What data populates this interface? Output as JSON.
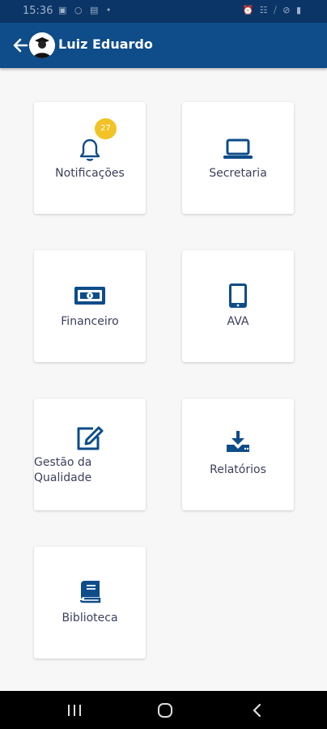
{
  "status_bar": {
    "time": "15:36",
    "left_icons": "▣ ○ ▤ •",
    "right_icons": "⏰ ☷ ⧸ ⊘ ▮"
  },
  "header": {
    "title": "Luiz Eduardo",
    "back_icon": "arrow-left-icon",
    "avatar_icon": "user-avatar-icon"
  },
  "menu": [
    {
      "label": "Notificações",
      "icon": "bell-icon",
      "badge": "27"
    },
    {
      "label": "Secretaria",
      "icon": "laptop-icon"
    },
    {
      "label": "Financeiro",
      "icon": "money-bill-icon"
    },
    {
      "label": "AVA",
      "icon": "tablet-icon"
    },
    {
      "label": "Gestão da Qualidade",
      "icon": "edit-icon"
    },
    {
      "label": "Relatórios",
      "icon": "download-icon"
    },
    {
      "label": "Biblioteca",
      "icon": "book-icon"
    }
  ],
  "colors": {
    "appbar": "#0e4c8a",
    "statusbar": "#0b3566",
    "icon": "#0e4c8a",
    "badge": "#f2c326",
    "label": "#3b3f5c",
    "background": "#f7f7f7"
  },
  "nav_bar": {
    "recents_icon": "recents-icon",
    "home_icon": "home-icon",
    "back_icon": "back-chevron-icon"
  }
}
